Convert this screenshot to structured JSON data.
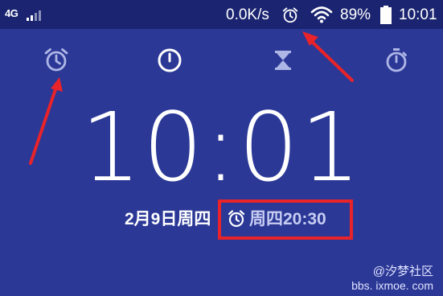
{
  "status_bar": {
    "network": "4G",
    "speed": "0.0K/s",
    "battery": "89%",
    "time": "10:01",
    "icons": [
      "signal-icon",
      "alarm-icon",
      "wifi-icon",
      "battery-icon"
    ]
  },
  "tabs": [
    {
      "icon": "alarm-clock-icon",
      "active": false
    },
    {
      "icon": "clock-icon",
      "active": true
    },
    {
      "icon": "hourglass-icon",
      "active": false
    },
    {
      "icon": "stopwatch-icon",
      "active": false
    }
  ],
  "clock": {
    "time": "10:01",
    "date": "2月9日周四",
    "next_alarm": "周四20:30"
  },
  "watermark": {
    "line1": "@汐梦社区",
    "line2": "bbs. ixmoe. com"
  },
  "colors": {
    "background": "#2b3896",
    "status_bar": "#1a2470",
    "annotation_red": "#e8232a"
  }
}
